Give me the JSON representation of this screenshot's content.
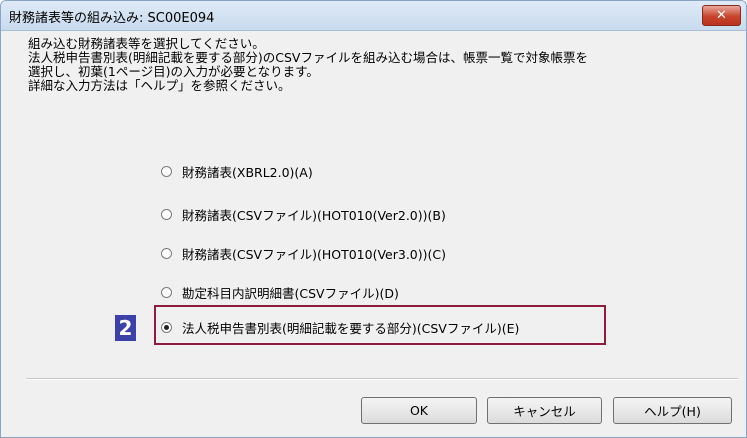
{
  "window": {
    "title": "財務諸表等の組み込み: SC00E094",
    "close_symbol": "✕"
  },
  "instructions": [
    "組み込む財務諸表等を選択してください。",
    "法人税申告書別表(明細記載を要する部分)のCSVファイルを組み込む場合は、帳票一覧で対象帳票を",
    "選択し、初葉(1ページ目)の入力が必要となります。",
    "詳細な入力方法は「ヘルプ」を参照ください。"
  ],
  "options": [
    {
      "label": "財務諸表(XBRL2.0)(A)",
      "selected": false
    },
    {
      "label": "財務諸表(CSVファイル)(HOT010(Ver2.0))(B)",
      "selected": false
    },
    {
      "label": "財務諸表(CSVファイル)(HOT010(Ver3.0))(C)",
      "selected": false
    },
    {
      "label": "勘定科目内訳明細書(CSVファイル)(D)",
      "selected": false
    },
    {
      "label": "法人税申告書別表(明細記載を要する部分)(CSVファイル)(E)",
      "selected": true
    }
  ],
  "step_badge": "2",
  "buttons": {
    "ok": "OK",
    "cancel": "キャンセル",
    "help": "ヘルプ(H)"
  },
  "colors": {
    "highlight_border": "#8e1c3f",
    "badge_background": "#3b41a8",
    "close_button": "#c7432c"
  }
}
